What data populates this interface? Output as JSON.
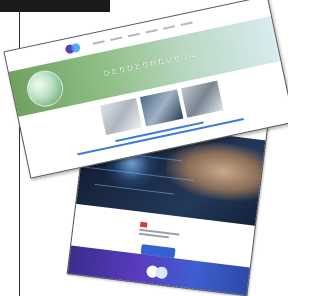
{
  "scene": {
    "description_color_accent": "#3562d2",
    "footer_gradient": [
      "#3b2c8c",
      "#5a3cc0",
      "#3d5fd0"
    ]
  },
  "front_page": {
    "hero_title": "ひとりひとりがたいせつに"
  },
  "icons": {
    "brand_logo": "brand-logo-icon",
    "globe": "globe-image",
    "hand": "hand-image"
  }
}
